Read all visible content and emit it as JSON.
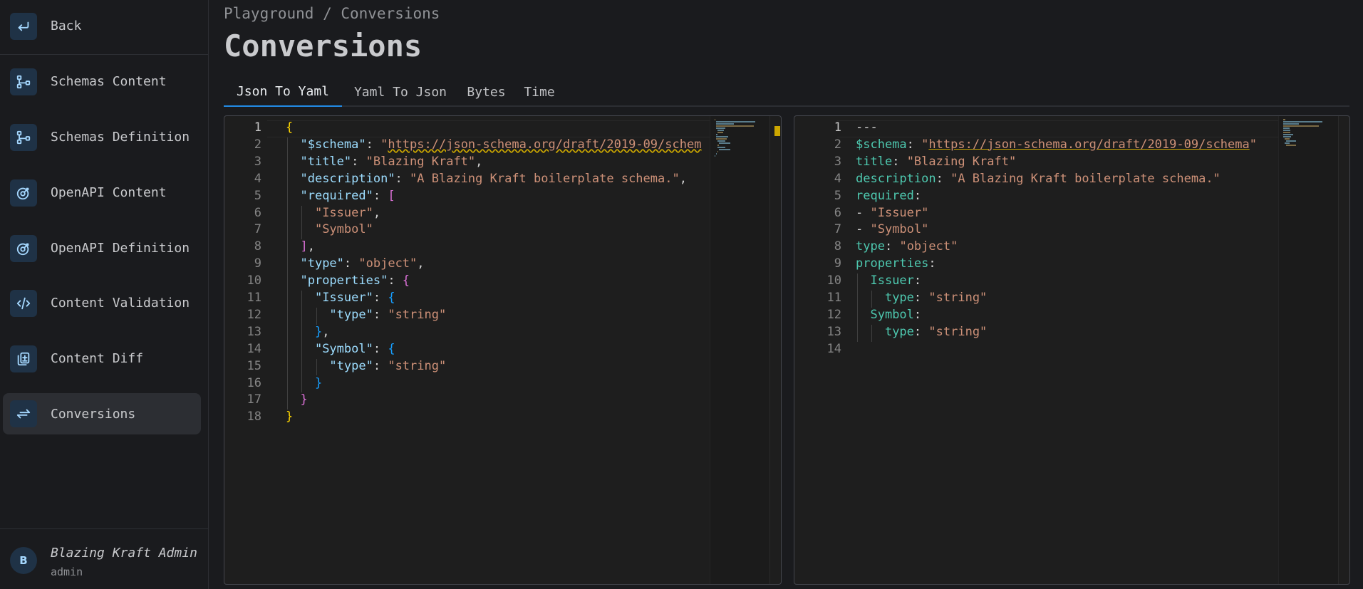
{
  "sidebar": {
    "back_label": "Back",
    "items": [
      {
        "label": "Schemas Content",
        "icon": "schema-icon"
      },
      {
        "label": "Schemas Definition",
        "icon": "schema-icon"
      },
      {
        "label": "OpenAPI Content",
        "icon": "openapi-icon"
      },
      {
        "label": "OpenAPI Definition",
        "icon": "openapi-icon"
      },
      {
        "label": "Content Validation",
        "icon": "code-icon"
      },
      {
        "label": "Content Diff",
        "icon": "file-diff-icon"
      },
      {
        "label": "Conversions",
        "icon": "arrows-exchange-icon",
        "active": true
      }
    ],
    "user": {
      "initial": "B",
      "name": "Blazing Kraft Admin",
      "role": "admin"
    }
  },
  "header": {
    "breadcrumb": "Playground / Conversions",
    "title": "Conversions"
  },
  "tabs": [
    {
      "label": "Json To Yaml",
      "active": true
    },
    {
      "label": "Yaml To Json"
    },
    {
      "label": "Bytes"
    },
    {
      "label": "Time"
    }
  ],
  "json_editor": {
    "line_numbers": [
      "1",
      "2",
      "3",
      "4",
      "5",
      "6",
      "7",
      "8",
      "9",
      "10",
      "11",
      "12",
      "13",
      "14",
      "15",
      "16",
      "17",
      "18"
    ],
    "lines": [
      "{",
      "  \"$schema\": \"https://json-schema.org/draft/2019-09/schem",
      "  \"title\": \"Blazing Kraft\",",
      "  \"description\": \"A Blazing Kraft boilerplate schema.\",",
      "  \"required\": [",
      "    \"Issuer\",",
      "    \"Symbol\"",
      "  ],",
      "  \"type\": \"object\",",
      "  \"properties\": {",
      "    \"Issuer\": {",
      "      \"type\": \"string\"",
      "    },",
      "    \"Symbol\": {",
      "      \"type\": \"string\"",
      "    }",
      "  }",
      "}"
    ]
  },
  "yaml_editor": {
    "line_numbers": [
      "1",
      "2",
      "3",
      "4",
      "5",
      "6",
      "7",
      "8",
      "9",
      "10",
      "11",
      "12",
      "13",
      "14"
    ],
    "lines": [
      "---",
      "$schema: \"https://json-schema.org/draft/2019-09/schema\"",
      "title: \"Blazing Kraft\"",
      "description: \"A Blazing Kraft boilerplate schema.\"",
      "required:",
      "- \"Issuer\"",
      "- \"Symbol\"",
      "type: \"object\"",
      "properties:",
      "  Issuer:",
      "    type: \"string\"",
      "  Symbol:",
      "    type: \"string\"",
      ""
    ]
  },
  "colors": {
    "accent": "#228be6",
    "icon_bg": "#1f3246",
    "active_bg": "#2c2e33"
  }
}
